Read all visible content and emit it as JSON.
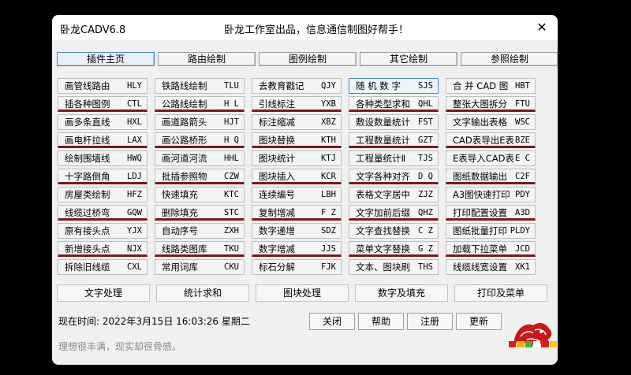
{
  "window": {
    "title": "卧龙CADV6.8",
    "tagline": "卧龙工作室出品，信息通信制图好帮手！",
    "close_glyph": "✕"
  },
  "tabs": [
    {
      "label": "插件主页",
      "active": true
    },
    {
      "label": "路由绘制",
      "active": false
    },
    {
      "label": "图例绘制",
      "active": false
    },
    {
      "label": "其它绘制",
      "active": false
    },
    {
      "label": "参照绘制",
      "active": false
    }
  ],
  "columns": [
    [
      {
        "name": "画管线路由",
        "code": "HLY"
      },
      {
        "name": "插各种图例",
        "code": "CTL",
        "red": true
      },
      {
        "name": "画多条直线",
        "code": "HXL"
      },
      {
        "name": "画电杆拉线",
        "code": "LAX",
        "red": true
      },
      {
        "name": "绘制围墙线",
        "code": "HWQ"
      },
      {
        "name": "十字路倒角",
        "code": "LDJ",
        "red": true
      },
      {
        "name": "房屋类绘制",
        "code": "HFZ"
      },
      {
        "name": "线缆过桥弯",
        "code": "GQW",
        "red": true
      },
      {
        "name": "原有接头点",
        "code": "YJX"
      },
      {
        "name": "新增接头点",
        "code": "NJX",
        "red": true
      },
      {
        "name": "拆除旧线缆",
        "code": "CXL"
      }
    ],
    [
      {
        "name": "铁路线绘制",
        "code": "TLU"
      },
      {
        "name": "公路线绘制",
        "code": "H L",
        "red": true
      },
      {
        "name": "画道路箭头",
        "code": "HJT"
      },
      {
        "name": "画公路桥形",
        "code": "H Q",
        "red": true
      },
      {
        "name": "画河道河流",
        "code": "HHL"
      },
      {
        "name": "批插参照物",
        "code": "CZW",
        "red": true
      },
      {
        "name": "快速填充",
        "code": "KTC"
      },
      {
        "name": "删除填充",
        "code": "STC",
        "red": true
      },
      {
        "name": "自动序号",
        "code": "ZXH"
      },
      {
        "name": "线路类图库",
        "code": "TKU",
        "red": true
      },
      {
        "name": "常用词库",
        "code": "CKU"
      }
    ],
    [
      {
        "name": "去教育戳记",
        "code": "QJY"
      },
      {
        "name": "引线标注",
        "code": "YXB",
        "red": true
      },
      {
        "name": "标注缩减",
        "code": "XBZ"
      },
      {
        "name": "图块替换",
        "code": "KTH",
        "red": true
      },
      {
        "name": "图块统计",
        "code": "KTJ"
      },
      {
        "name": "图块插入",
        "code": "KCR",
        "red": true
      },
      {
        "name": "连续编号",
        "code": "LBH"
      },
      {
        "name": "复制增减",
        "code": "F Z",
        "red": true
      },
      {
        "name": "数字递增",
        "code": "SDZ"
      },
      {
        "name": "数字增减",
        "code": "JJS",
        "red": true
      },
      {
        "name": "标石分解",
        "code": "FJK"
      }
    ],
    [
      {
        "name": "随 机 数 字",
        "code": "SJS",
        "sel": true
      },
      {
        "name": "各种类型求和",
        "code": "QHL",
        "red": true
      },
      {
        "name": "敷设数量统计",
        "code": "FST"
      },
      {
        "name": "工程数量统计",
        "code": "GZT",
        "red": true
      },
      {
        "name": "工程量统计Ⅱ",
        "code": "TJS"
      },
      {
        "name": "文字各种对齐",
        "code": "D Q",
        "red": true
      },
      {
        "name": "表格文字居中",
        "code": "ZJZ"
      },
      {
        "name": "文字加前后缀",
        "code": "QHZ",
        "red": true
      },
      {
        "name": "文字查找替换",
        "code": "C Z"
      },
      {
        "name": "菜单文字替换",
        "code": "G Z",
        "red": true
      },
      {
        "name": "文本、图块刷",
        "code": "THS"
      }
    ],
    [
      {
        "name": "合 并 CAD 图",
        "code": "HBT"
      },
      {
        "name": "整张大图拆分",
        "code": "FTU",
        "red": true
      },
      {
        "name": "文字输出表格",
        "code": "WSC"
      },
      {
        "name": "CAD表导出E表",
        "code": "BZE",
        "red": true
      },
      {
        "name": "E表导入CAD表",
        "code": "E C"
      },
      {
        "name": "图纸数据输出",
        "code": "C2F",
        "red": true
      },
      {
        "name": "A3图快速打印",
        "code": "PDY"
      },
      {
        "name": "打印配置设置",
        "code": "A3D",
        "red": true
      },
      {
        "name": "图纸批量打印",
        "code": "PLDY"
      },
      {
        "name": "加载下拉菜单",
        "code": "JCD",
        "red": true
      },
      {
        "name": "线缆线宽设置",
        "code": "XK1"
      }
    ]
  ],
  "categories": [
    "文字处理",
    "统计求和",
    "图块处理",
    "数字及填充",
    "打印及菜单"
  ],
  "status": {
    "datetime_label": "现在时间:",
    "date": "2022年3月15日",
    "time": "16:03:26",
    "weekday": "星期二"
  },
  "buttons": {
    "close": "关闭",
    "help": "帮助",
    "register": "注册",
    "update": "更新"
  },
  "motto": "理想很丰满，现实却很骨感。",
  "logo": {
    "colors": [
      "#d42020",
      "#f2b400",
      "#3fae3a",
      "#ffffff",
      "#d42020",
      "#f2d000"
    ]
  }
}
